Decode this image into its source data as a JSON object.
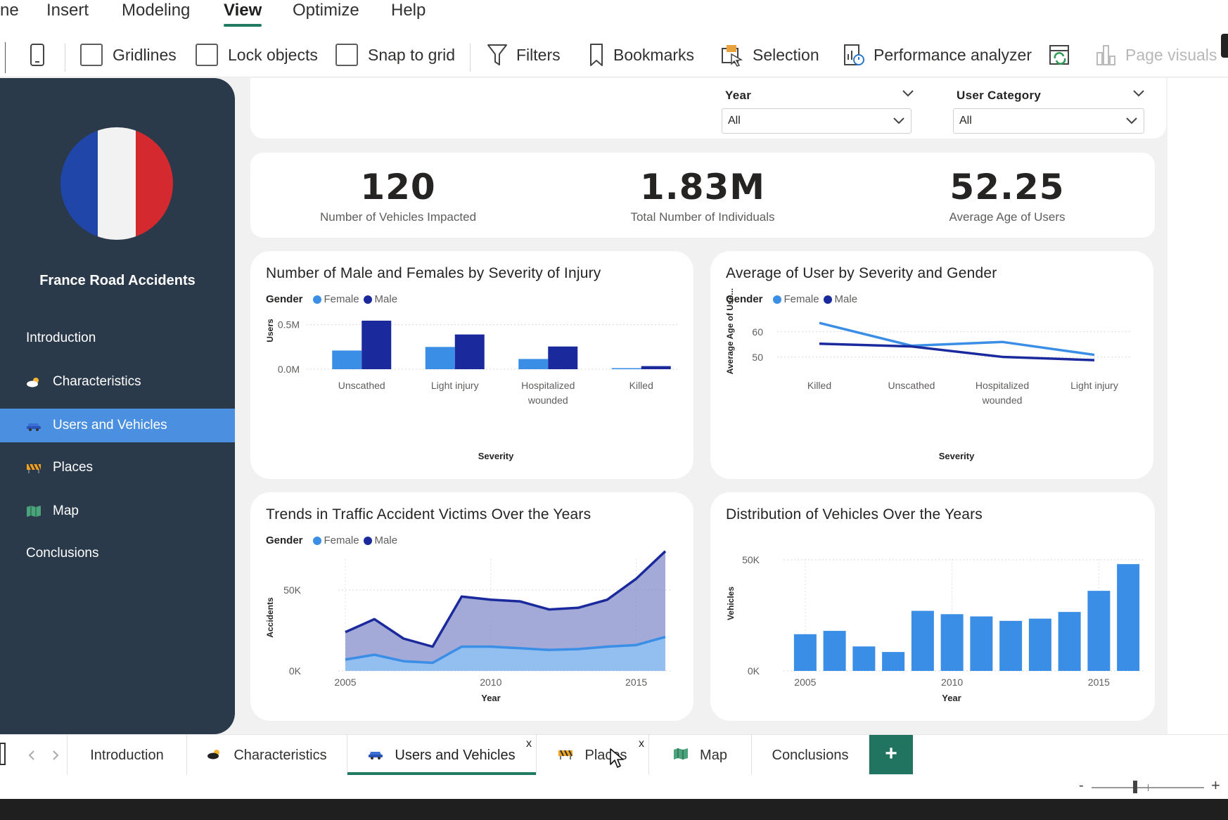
{
  "menu": {
    "items": [
      {
        "label": "ne"
      },
      {
        "label": "Insert"
      },
      {
        "label": "Modeling"
      },
      {
        "label": "View"
      },
      {
        "label": "Optimize"
      },
      {
        "label": "Help"
      }
    ],
    "active": "View"
  },
  "ribbon": {
    "gridlines": "Gridlines",
    "lock_objects": "Lock objects",
    "snap_to_grid": "Snap to grid",
    "filters": "Filters",
    "bookmarks": "Bookmarks",
    "selection": "Selection",
    "performance_analyzer": "Performance analyzer",
    "page_visuals": "Page visuals"
  },
  "sidebar": {
    "title": "France Road Accidents",
    "flag_colors": [
      "#1f46a8",
      "#f2f2f2",
      "#d42a2f"
    ],
    "items": [
      {
        "label": "Introduction",
        "icon": ""
      },
      {
        "label": "Characteristics",
        "icon": "cloud-sun-icon"
      },
      {
        "label": "Users and Vehicles",
        "icon": "car-icon"
      },
      {
        "label": "Places",
        "icon": "roadblock-icon"
      },
      {
        "label": "Map",
        "icon": "map-icon"
      },
      {
        "label": "Conclusions",
        "icon": ""
      }
    ],
    "active": "Users and Vehicles"
  },
  "slicers": {
    "year": {
      "label": "Year",
      "value": "All"
    },
    "user_category": {
      "label": "User Category",
      "value": "All"
    }
  },
  "kpis": [
    {
      "value": "120",
      "label": "Number of Vehicles Impacted"
    },
    {
      "value": "1.83M",
      "label": "Total Number of Individuals"
    },
    {
      "value": "52.25",
      "label": "Average Age of Users"
    }
  ],
  "legend": {
    "title": "Gender",
    "female": "Female",
    "male": "Male"
  },
  "colors": {
    "female": "#3a8ee6",
    "male": "#1a2a9c",
    "accent": "#1f7a64",
    "sidebar": "#2b3a4b",
    "nav_active": "#4a8fe0"
  },
  "chart_data": [
    {
      "type": "bar",
      "title": "Number of Male and Females by Severity of Injury",
      "xlabel": "Severity",
      "ylabel": "Users",
      "categories": [
        "Unscathed",
        "Light injury",
        "Hospitalized wounded",
        "Killed"
      ],
      "category_lines": [
        [
          "Unscathed"
        ],
        [
          "Light injury"
        ],
        [
          "Hospitalized",
          "wounded"
        ],
        [
          "Killed"
        ]
      ],
      "series": [
        {
          "name": "Female",
          "values": [
            0.21,
            0.25,
            0.115,
            0.012
          ]
        },
        {
          "name": "Male",
          "values": [
            0.545,
            0.39,
            0.255,
            0.035
          ]
        }
      ],
      "ylim": [
        0,
        0.6
      ],
      "yticks": [
        {
          "v": 0,
          "label": "0.0M"
        },
        {
          "v": 0.5,
          "label": "0.5M"
        }
      ],
      "legend": "top-left"
    },
    {
      "type": "line",
      "title": "Average of User by Severity and Gender",
      "xlabel": "Severity",
      "ylabel": "Average Age of Use...",
      "categories": [
        "Killed",
        "Unscathed",
        "Hospitalized wounded",
        "Light injury"
      ],
      "category_lines": [
        [
          "Killed"
        ],
        [
          "Unscathed"
        ],
        [
          "Hospitalized",
          "wounded"
        ],
        [
          "Light injury"
        ]
      ],
      "series": [
        {
          "name": "Female",
          "values": [
            63.5,
            54.5,
            56.0,
            50.9
          ]
        },
        {
          "name": "Male",
          "values": [
            55.3,
            54.2,
            50.1,
            48.8
          ]
        }
      ],
      "ylim": [
        43,
        68
      ],
      "yticks": [
        {
          "v": 50,
          "label": "50"
        },
        {
          "v": 60,
          "label": "60"
        }
      ],
      "legend": "top-left"
    },
    {
      "type": "area",
      "title": "Trends in Traffic Accident Victims Over the Years",
      "xlabel": "Year",
      "ylabel": "Accidents",
      "x": [
        2005,
        2006,
        2007,
        2008,
        2009,
        2010,
        2011,
        2012,
        2013,
        2014,
        2015,
        2016
      ],
      "series": [
        {
          "name": "Female",
          "values": [
            7,
            10,
            6,
            5,
            15,
            15,
            14,
            13,
            13.5,
            15,
            16,
            21
          ]
        },
        {
          "name": "Male",
          "values": [
            24,
            32,
            20,
            15,
            46,
            44,
            43,
            38,
            39,
            44,
            57,
            74
          ]
        }
      ],
      "ylim": [
        0,
        80
      ],
      "yticks": [
        {
          "v": 0,
          "label": "0K"
        },
        {
          "v": 50,
          "label": "50K"
        }
      ],
      "xticks": [
        2005,
        2010,
        2015
      ],
      "legend": "top-left"
    },
    {
      "type": "bar",
      "title": "Distribution of Vehicles Over the Years",
      "xlabel": "Year",
      "ylabel": "Vehicles",
      "x": [
        2005,
        2006,
        2007,
        2008,
        2009,
        2010,
        2011,
        2012,
        2013,
        2014,
        2015,
        2016
      ],
      "values": [
        16.5,
        18,
        11,
        8.5,
        27,
        25.5,
        24.5,
        22.5,
        23.5,
        26.5,
        36,
        48
      ],
      "ylim": [
        0,
        55
      ],
      "yticks": [
        {
          "v": 0,
          "label": "0K"
        },
        {
          "v": 50,
          "label": "50K"
        }
      ],
      "xticks": [
        2005,
        2010,
        2015
      ]
    }
  ],
  "page_tabs": [
    {
      "label": "Introduction",
      "icon": ""
    },
    {
      "label": "Characteristics",
      "icon": "cloud-sun-icon"
    },
    {
      "label": "Users and Vehicles",
      "icon": "car-icon",
      "close": "x"
    },
    {
      "label": "Places",
      "icon": "roadblock-icon",
      "close": "x"
    },
    {
      "label": "Map",
      "icon": "map-icon"
    },
    {
      "label": "Conclusions",
      "icon": ""
    }
  ],
  "add_page": "+",
  "zoom": {
    "minus": "-",
    "plus": "+"
  }
}
